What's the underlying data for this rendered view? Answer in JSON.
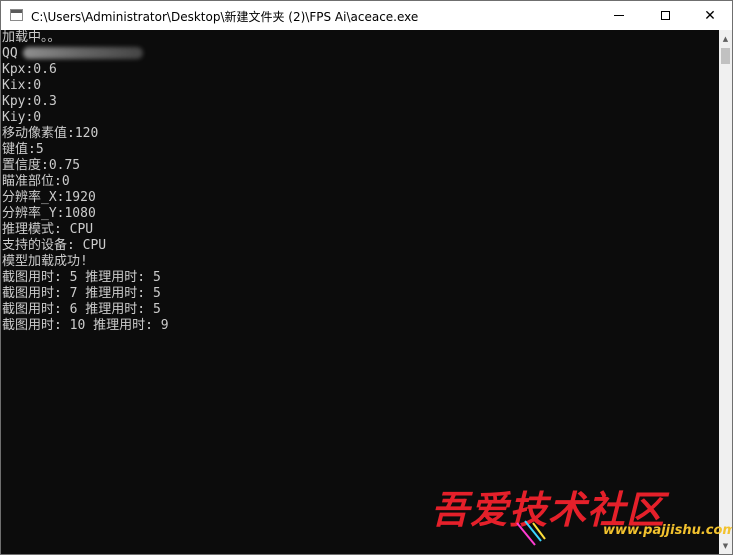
{
  "window": {
    "title": "C:\\Users\\Administrator\\Desktop\\新建文件夹 (2)\\FPS Ai\\aceace.exe",
    "icons": {
      "app": "console-app-icon",
      "minimize": "minimize-icon",
      "maximize": "maximize-icon",
      "close": "close-icon"
    },
    "close_glyph": "✕"
  },
  "console": {
    "lines": [
      "加载中。。",
      "QQ",
      "Kpx:0.6",
      "Kix:0",
      "Kpy:0.3",
      "Kiy:0",
      "移动像素值:120",
      "键值:5",
      "置信度:0.75",
      "瞄准部位:0",
      "分辨率_X:1920",
      "分辨率_Y:1080",
      "推理模式: CPU",
      "支持的设备: CPU",
      "模型加载成功!",
      "截图用时: 5 推理用时: 5",
      "截图用时: 7 推理用时: 5",
      "截图用时: 6 推理用时: 5",
      "截图用时: 10 推理用时: 9"
    ],
    "text_color": "#cccccc",
    "background": "#0c0c0c"
  },
  "scrollbar": {
    "up_arrow": "▲",
    "down_arrow": "▼"
  },
  "watermark": {
    "title": "吾爱技术社区",
    "url": "www.pajjishu.com",
    "color": "#e5202a",
    "url_color": "#f2c22e"
  }
}
